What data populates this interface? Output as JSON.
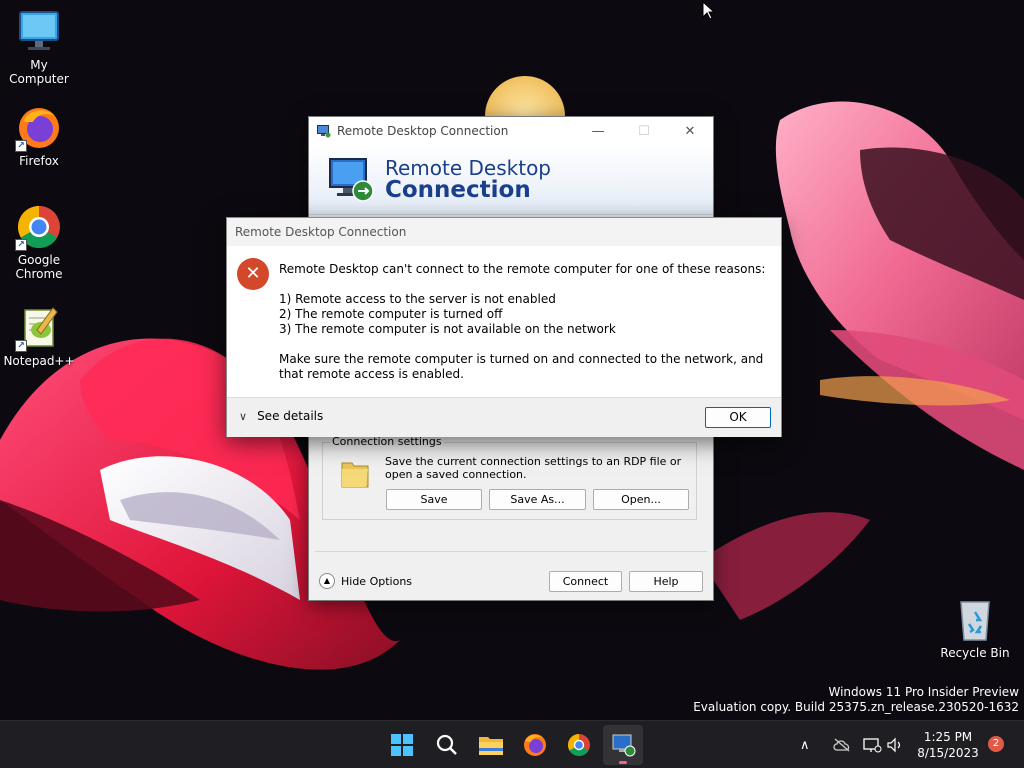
{
  "desktop": {
    "icons": [
      {
        "label": "My Computer"
      },
      {
        "label": "Firefox"
      },
      {
        "label": "Google Chrome"
      },
      {
        "label": "Notepad++"
      },
      {
        "label": "Recycle Bin"
      }
    ],
    "watermark": {
      "line1": "Windows 11 Pro Insider Preview",
      "line2": "Evaluation copy. Build 25375.zn_release.230520-1632"
    }
  },
  "rdp_window": {
    "title": "Remote Desktop Connection",
    "banner_line1": "Remote Desktop",
    "banner_line2": "Connection",
    "connection_settings": {
      "legend": "Connection settings",
      "description": "Save the current connection settings to an RDP file or open a saved connection.",
      "save_label": "Save",
      "save_as_label": "Save As...",
      "open_label": "Open..."
    },
    "hide_options_label": "Hide Options",
    "connect_label": "Connect",
    "help_label": "Help"
  },
  "error_dialog": {
    "title": "Remote Desktop Connection",
    "message": "Remote Desktop can't connect to the remote computer for one of these reasons:",
    "reasons": [
      "1) Remote access to the server is not enabled",
      "2) The remote computer is turned off",
      "3) The remote computer is not available on the network"
    ],
    "advice": "Make sure the remote computer is turned on and connected to the network, and that remote access is enabled.",
    "see_details_label": "See details",
    "ok_label": "OK"
  },
  "taskbar": {
    "apps": [
      "start",
      "search",
      "file-explorer",
      "firefox",
      "chrome",
      "remote-desktop"
    ],
    "active_app": "remote-desktop",
    "time": "1:25 PM",
    "date": "8/15/2023",
    "notification_count": "2"
  }
}
